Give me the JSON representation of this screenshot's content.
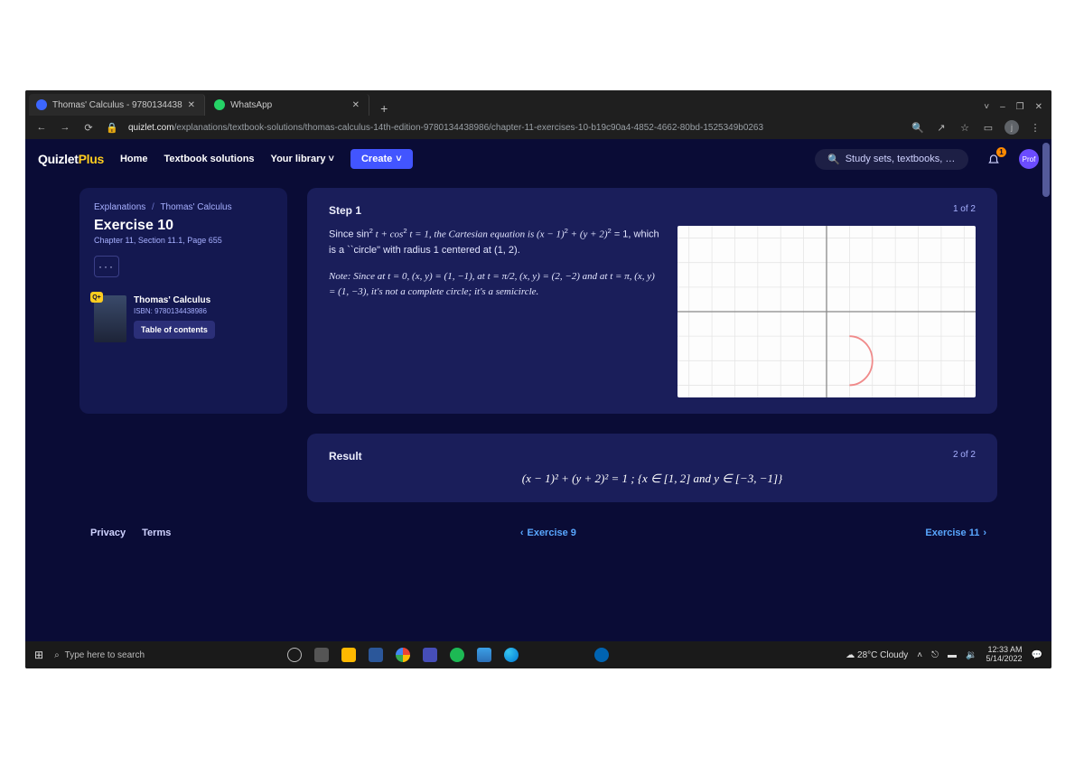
{
  "browser": {
    "tabs": [
      {
        "label": "Thomas' Calculus - 9780134438",
        "fav_color": "#3c66ff"
      },
      {
        "label": "WhatsApp",
        "fav_color": "#25d366"
      }
    ],
    "window_controls": {
      "min": "–",
      "restore": "❐",
      "close": "✕",
      "expand": "⇲",
      "down": "˅"
    },
    "nav": {
      "back": "←",
      "forward": "→",
      "reload": "⟳",
      "lock": "🔒"
    },
    "url_host": "quizlet.com",
    "url_path": "/explanations/textbook-solutions/thomas-calculus-14th-edition-9780134438986/chapter-11-exercises-10-b19c90a4-4852-4662-80bd-1525349b0263",
    "right_icons": {
      "zoom": "🔍",
      "share": "↗",
      "star": "☆",
      "ext": "▭",
      "profile": "j",
      "menu": "⋮"
    }
  },
  "site": {
    "logo_main": "Quizlet",
    "logo_suffix": "Plus",
    "nav": [
      "Home",
      "Textbook solutions",
      "Your library"
    ],
    "library_chev": "˅",
    "create": "Create",
    "create_chev": "˅",
    "search_placeholder": "Study sets, textbooks, …",
    "search_icon": "🔍",
    "bell_badge": "1",
    "avatar_label": "Prof"
  },
  "sidebar": {
    "crumb1": "Explanations",
    "crumb2": "Thomas' Calculus",
    "title": "Exercise 10",
    "subtitle": "Chapter 11, Section 11.1, Page 655",
    "more": "···",
    "book_title": "Thomas' Calculus",
    "isbn": "ISBN: 9780134438986",
    "toc": "Table of contents",
    "badge": "Q+"
  },
  "step": {
    "heading": "Step 1",
    "count": "1 of 2",
    "p1a": "Since sin",
    "p1b": " t + cos",
    "p1c": " t = 1, the Cartesian equation is (x − 1)",
    "p1d": " + (y + 2)",
    "p1e": " = 1, which is a ``circle\" with radius 1 centered at (1,  2).",
    "p2": "Note: Since at t = 0, (x, y) = (1, −1), at t = π/2, (x, y) = (2, −2) and at t = π, (x, y) = (1, −3), it's not a complete circle; it's a semicircle."
  },
  "result": {
    "heading": "Result",
    "count": "2 of 2",
    "eq": "(x − 1)² + (y + 2)² = 1 ; {x ∈ [1, 2] and y ∈ [−3, −1]}"
  },
  "footer": {
    "privacy": "Privacy",
    "terms": "Terms",
    "prev": "Exercise 9",
    "next": "Exercise 11"
  },
  "taskbar": {
    "search_placeholder": "Type here to search",
    "weather": "28°C  Cloudy",
    "time": "12:33 AM",
    "date": "5/14/2022"
  },
  "chart_data": {
    "type": "line",
    "title": "",
    "xlabel": "",
    "ylabel": "",
    "xlim": [
      -6,
      6
    ],
    "ylim": [
      -3,
      3
    ],
    "grid": true,
    "series": [
      {
        "name": "semicircle",
        "param": "t∈[0,π]",
        "x": [
          1.0,
          1.71,
          2.0,
          1.71,
          1.0
        ],
        "y": [
          -1.0,
          -1.29,
          -2.0,
          -2.71,
          -3.0
        ]
      }
    ],
    "axis_ticks_x": [
      -6,
      -5,
      -4,
      -3,
      -2,
      -1,
      0,
      1,
      2,
      3,
      4,
      5,
      6
    ],
    "axis_ticks_y": [
      -3,
      -2,
      -1,
      0,
      1,
      2,
      3
    ]
  }
}
